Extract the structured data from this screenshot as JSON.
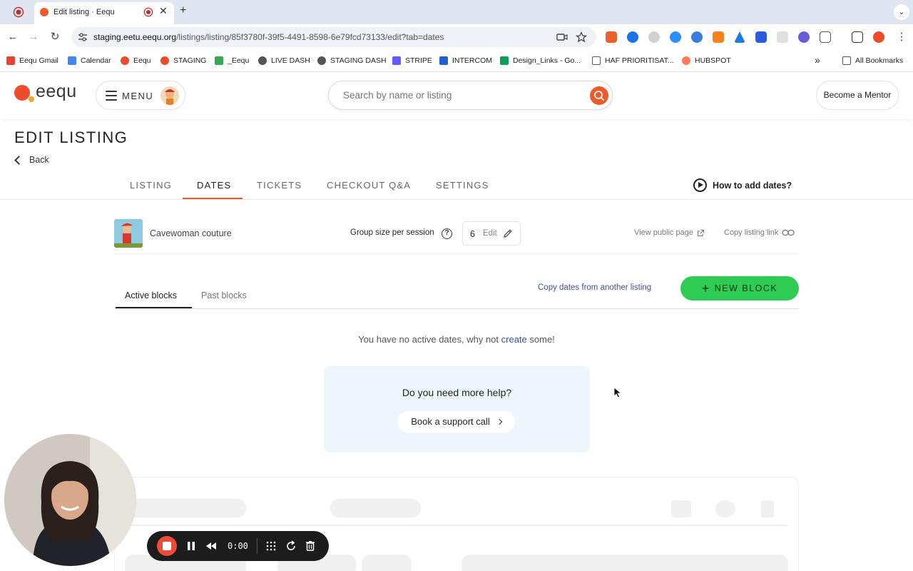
{
  "browser": {
    "tab_title": "Edit listing · Eequ",
    "new_tab_label": "+",
    "url_host": "staging.eetu.eequ.org",
    "url_path": "/listings/listing/85f3780f-39f5-4491-8598-6e79fcd73133/edit?tab=dates",
    "bookmarks": [
      {
        "label": "Eequ Gmail",
        "color": "#ea4335"
      },
      {
        "label": "Calendar",
        "color": "#4285f4"
      },
      {
        "label": "Eequ",
        "color": "#ee4b2b"
      },
      {
        "label": "STAGING",
        "color": "#ee4b2b"
      },
      {
        "label": "_Eequ",
        "color": "#34a853"
      },
      {
        "label": "LIVE DASH",
        "color": "#555555"
      },
      {
        "label": "STAGING DASH",
        "color": "#555555"
      },
      {
        "label": "STRIPE",
        "color": "#635bff"
      },
      {
        "label": "INTERCOM",
        "color": "#1f5fd6"
      },
      {
        "label": "Design_Links - Go...",
        "color": "#0f9d58"
      },
      {
        "label": "HAF PRIORITISAT...",
        "color": "#555555"
      },
      {
        "label": "HUBSPOT",
        "color": "#ff7a59"
      }
    ],
    "bookmarks_overflow": "»",
    "all_bookmarks": "All Bookmarks"
  },
  "header": {
    "logo_text": "eequ",
    "menu_label": "MENU",
    "search_placeholder": "Search by name or listing",
    "mentor_button": "Become a Mentor"
  },
  "page": {
    "title": "EDIT LISTING",
    "back_label": "Back",
    "tabs": [
      "LISTING",
      "DATES",
      "TICKETS",
      "CHECKOUT Q&A",
      "SETTINGS"
    ],
    "active_tab": "DATES",
    "how_to": "How to add dates?"
  },
  "listing": {
    "name": "Cavewoman couture",
    "group_label": "Group size per session",
    "group_size": "6",
    "edit_label": "Edit",
    "view_public": "View public page",
    "copy_link": "Copy listing link"
  },
  "blocks": {
    "tabs": [
      "Active blocks",
      "Past blocks"
    ],
    "copy_dates": "Copy dates from another listing",
    "new_block": "NEW BLOCK",
    "empty_prefix": "You have no active dates, why not ",
    "empty_link": "create",
    "empty_suffix": " some!"
  },
  "help": {
    "title": "Do you need more help?",
    "button": "Book a support call"
  },
  "recorder": {
    "time": "0:00"
  },
  "colors": {
    "brand": "#ef5a2c",
    "accent_green": "#2ecc52",
    "link_blue": "#3a4fa8"
  }
}
